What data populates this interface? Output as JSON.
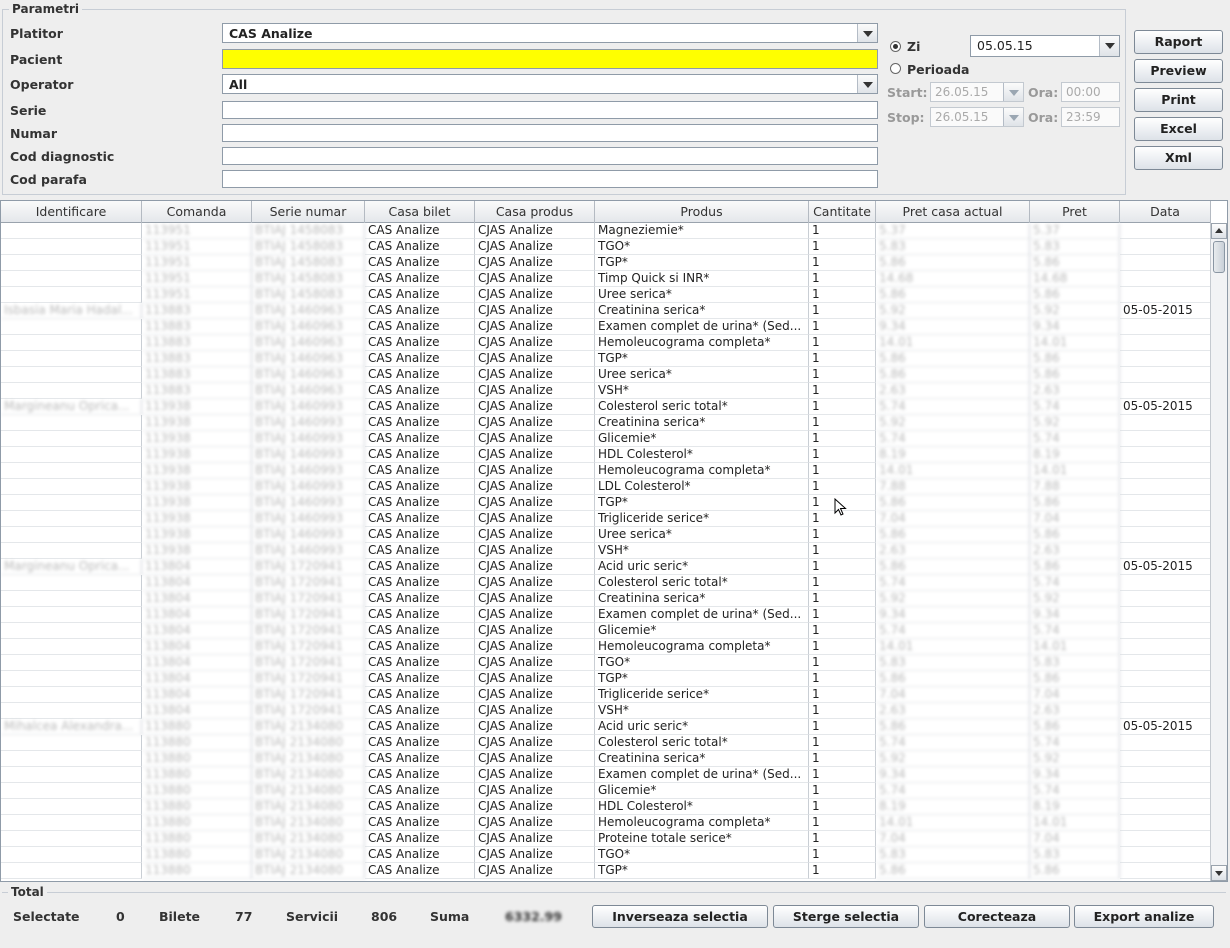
{
  "params": {
    "title": "Parametri",
    "platitor": {
      "label": "Platitor",
      "value": "CAS Analize"
    },
    "pacient": {
      "label": "Pacient",
      "value": ""
    },
    "operator": {
      "label": "Operator",
      "value": "All"
    },
    "serie": {
      "label": "Serie",
      "value": ""
    },
    "numar": {
      "label": "Numar",
      "value": ""
    },
    "cod_diagnostic": {
      "label": "Cod diagnostic",
      "value": ""
    },
    "cod_parafa": {
      "label": "Cod parafa",
      "value": ""
    }
  },
  "date": {
    "zi_label": "Zi",
    "zi_value": "05.05.15",
    "perioada_label": "Perioada",
    "start_label": "Start:",
    "stop_label": "Stop:",
    "ora_label": "Ora:",
    "start_date": "26.05.15",
    "start_time": "00:00",
    "stop_date": "26.05.15",
    "stop_time": "23:59"
  },
  "buttons": {
    "raport": "Raport",
    "preview": "Preview",
    "print": "Print",
    "excel": "Excel",
    "xml": "Xml"
  },
  "table": {
    "columns": [
      "Identificare",
      "Comanda",
      "Serie numar",
      "Casa bilet",
      "Casa produs",
      "Produs",
      "Cantitate",
      "Pret casa actual",
      "Pret",
      "Data"
    ],
    "rows": [
      [
        "",
        "113951",
        "BTIAJ 1458083",
        "CAS Analize",
        "CJAS Analize",
        "Magneziemie*",
        "1",
        "5.37",
        "5.37",
        ""
      ],
      [
        "",
        "113951",
        "BTIAJ 1458083",
        "CAS Analize",
        "CJAS Analize",
        "TGO*",
        "1",
        "5.83",
        "5.83",
        ""
      ],
      [
        "",
        "113951",
        "BTIAJ 1458083",
        "CAS Analize",
        "CJAS Analize",
        "TGP*",
        "1",
        "5.86",
        "5.86",
        ""
      ],
      [
        "",
        "113951",
        "BTIAJ 1458083",
        "CAS Analize",
        "CJAS Analize",
        "Timp Quick si INR*",
        "1",
        "14.68",
        "14.68",
        ""
      ],
      [
        "",
        "113951",
        "BTIAJ 1458083",
        "CAS Analize",
        "CJAS Analize",
        "Uree serica*",
        "1",
        "5.86",
        "5.86",
        ""
      ],
      [
        "Isbasia Maria Hadal...",
        "113883",
        "BTIAJ 1460963",
        "CAS Analize",
        "CJAS Analize",
        "Creatinina serica*",
        "1",
        "5.92",
        "5.92",
        "05-05-2015"
      ],
      [
        "",
        "113883",
        "BTIAJ 1460963",
        "CAS Analize",
        "CJAS Analize",
        "Examen complet de urina* (Sed...",
        "1",
        "9.34",
        "9.34",
        ""
      ],
      [
        "",
        "113883",
        "BTIAJ 1460963",
        "CAS Analize",
        "CJAS Analize",
        "Hemoleucograma completa*",
        "1",
        "14.01",
        "14.01",
        ""
      ],
      [
        "",
        "113883",
        "BTIAJ 1460963",
        "CAS Analize",
        "CJAS Analize",
        "TGP*",
        "1",
        "5.86",
        "5.86",
        ""
      ],
      [
        "",
        "113883",
        "BTIAJ 1460963",
        "CAS Analize",
        "CJAS Analize",
        "Uree serica*",
        "1",
        "5.86",
        "5.86",
        ""
      ],
      [
        "",
        "113883",
        "BTIAJ 1460963",
        "CAS Analize",
        "CJAS Analize",
        "VSH*",
        "1",
        "2.63",
        "2.63",
        ""
      ],
      [
        "Margineanu Oprica...",
        "113938",
        "BTIAJ 1460993",
        "CAS Analize",
        "CJAS Analize",
        "Colesterol seric total*",
        "1",
        "5.74",
        "5.74",
        "05-05-2015"
      ],
      [
        "",
        "113938",
        "BTIAJ 1460993",
        "CAS Analize",
        "CJAS Analize",
        "Creatinina serica*",
        "1",
        "5.92",
        "5.92",
        ""
      ],
      [
        "",
        "113938",
        "BTIAJ 1460993",
        "CAS Analize",
        "CJAS Analize",
        "Glicemie*",
        "1",
        "5.74",
        "5.74",
        ""
      ],
      [
        "",
        "113938",
        "BTIAJ 1460993",
        "CAS Analize",
        "CJAS Analize",
        "HDL Colesterol*",
        "1",
        "8.19",
        "8.19",
        ""
      ],
      [
        "",
        "113938",
        "BTIAJ 1460993",
        "CAS Analize",
        "CJAS Analize",
        "Hemoleucograma completa*",
        "1",
        "14.01",
        "14.01",
        ""
      ],
      [
        "",
        "113938",
        "BTIAJ 1460993",
        "CAS Analize",
        "CJAS Analize",
        "LDL Colesterol*",
        "1",
        "7.88",
        "7.88",
        ""
      ],
      [
        "",
        "113938",
        "BTIAJ 1460993",
        "CAS Analize",
        "CJAS Analize",
        "TGP*",
        "1",
        "5.86",
        "5.86",
        ""
      ],
      [
        "",
        "113938",
        "BTIAJ 1460993",
        "CAS Analize",
        "CJAS Analize",
        "Trigliceride serice*",
        "1",
        "7.04",
        "7.04",
        ""
      ],
      [
        "",
        "113938",
        "BTIAJ 1460993",
        "CAS Analize",
        "CJAS Analize",
        "Uree serica*",
        "1",
        "5.86",
        "5.86",
        ""
      ],
      [
        "",
        "113938",
        "BTIAJ 1460993",
        "CAS Analize",
        "CJAS Analize",
        "VSH*",
        "1",
        "2.63",
        "2.63",
        ""
      ],
      [
        "Margineanu Oprica...",
        "113804",
        "BTIAJ 1720941",
        "CAS Analize",
        "CJAS Analize",
        "Acid uric seric*",
        "1",
        "5.86",
        "5.86",
        "05-05-2015"
      ],
      [
        "",
        "113804",
        "BTIAJ 1720941",
        "CAS Analize",
        "CJAS Analize",
        "Colesterol seric total*",
        "1",
        "5.74",
        "5.74",
        ""
      ],
      [
        "",
        "113804",
        "BTIAJ 1720941",
        "CAS Analize",
        "CJAS Analize",
        "Creatinina serica*",
        "1",
        "5.92",
        "5.92",
        ""
      ],
      [
        "",
        "113804",
        "BTIAJ 1720941",
        "CAS Analize",
        "CJAS Analize",
        "Examen complet de urina* (Sed...",
        "1",
        "9.34",
        "9.34",
        ""
      ],
      [
        "",
        "113804",
        "BTIAJ 1720941",
        "CAS Analize",
        "CJAS Analize",
        "Glicemie*",
        "1",
        "5.74",
        "5.74",
        ""
      ],
      [
        "",
        "113804",
        "BTIAJ 1720941",
        "CAS Analize",
        "CJAS Analize",
        "Hemoleucograma completa*",
        "1",
        "14.01",
        "14.01",
        ""
      ],
      [
        "",
        "113804",
        "BTIAJ 1720941",
        "CAS Analize",
        "CJAS Analize",
        "TGO*",
        "1",
        "5.83",
        "5.83",
        ""
      ],
      [
        "",
        "113804",
        "BTIAJ 1720941",
        "CAS Analize",
        "CJAS Analize",
        "TGP*",
        "1",
        "5.86",
        "5.86",
        ""
      ],
      [
        "",
        "113804",
        "BTIAJ 1720941",
        "CAS Analize",
        "CJAS Analize",
        "Trigliceride serice*",
        "1",
        "7.04",
        "7.04",
        ""
      ],
      [
        "",
        "113804",
        "BTIAJ 1720941",
        "CAS Analize",
        "CJAS Analize",
        "VSH*",
        "1",
        "2.63",
        "2.63",
        ""
      ],
      [
        "Mihalcea Alexandra...",
        "113880",
        "BTIAJ 2134080",
        "CAS Analize",
        "CJAS Analize",
        "Acid uric seric*",
        "1",
        "5.86",
        "5.86",
        "05-05-2015"
      ],
      [
        "",
        "113880",
        "BTIAJ 2134080",
        "CAS Analize",
        "CJAS Analize",
        "Colesterol seric total*",
        "1",
        "5.74",
        "5.74",
        ""
      ],
      [
        "",
        "113880",
        "BTIAJ 2134080",
        "CAS Analize",
        "CJAS Analize",
        "Creatinina serica*",
        "1",
        "5.92",
        "5.92",
        ""
      ],
      [
        "",
        "113880",
        "BTIAJ 2134080",
        "CAS Analize",
        "CJAS Analize",
        "Examen complet de urina* (Sed...",
        "1",
        "9.34",
        "9.34",
        ""
      ],
      [
        "",
        "113880",
        "BTIAJ 2134080",
        "CAS Analize",
        "CJAS Analize",
        "Glicemie*",
        "1",
        "5.74",
        "5.74",
        ""
      ],
      [
        "",
        "113880",
        "BTIAJ 2134080",
        "CAS Analize",
        "CJAS Analize",
        "HDL Colesterol*",
        "1",
        "8.19",
        "8.19",
        ""
      ],
      [
        "",
        "113880",
        "BTIAJ 2134080",
        "CAS Analize",
        "CJAS Analize",
        "Hemoleucograma completa*",
        "1",
        "14.01",
        "14.01",
        ""
      ],
      [
        "",
        "113880",
        "BTIAJ 2134080",
        "CAS Analize",
        "CJAS Analize",
        "Proteine totale serice*",
        "1",
        "7.04",
        "7.04",
        ""
      ],
      [
        "",
        "113880",
        "BTIAJ 2134080",
        "CAS Analize",
        "CJAS Analize",
        "TGO*",
        "1",
        "5.83",
        "5.83",
        ""
      ],
      [
        "",
        "113880",
        "BTIAJ 2134080",
        "CAS Analize",
        "CJAS Analize",
        "TGP*",
        "1",
        "5.86",
        "5.86",
        ""
      ]
    ]
  },
  "totals": {
    "title": "Total",
    "selectate_label": "Selectate",
    "selectate_value": "0",
    "bilete_label": "Bilete",
    "bilete_value": "77",
    "servicii_label": "Servicii",
    "servicii_value": "806",
    "suma_label": "Suma",
    "suma_value": "6332.99"
  },
  "actions": {
    "inverseaza": "Inverseaza selectia",
    "sterge": "Sterge selectia",
    "corecteaza": "Corecteaza",
    "export": "Export analize"
  },
  "colors": {
    "pacient_field": "#ffff00",
    "window_bg": "#eeeeee"
  }
}
